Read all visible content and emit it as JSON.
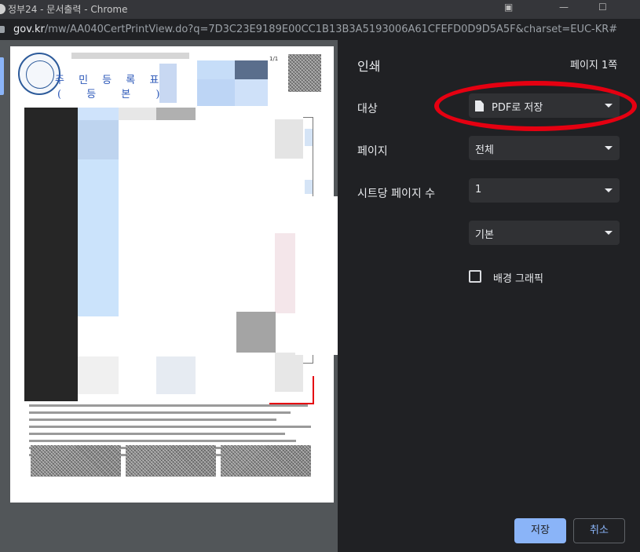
{
  "window": {
    "title": "정부24 - 문서출력 - Chrome",
    "url_host": "gov.kr",
    "url_path": "/mw/AA040CertPrintView.do?q=7D3C23E9189E00CC1B13B3A5193006A61CFEFD0D9D5A5F&charset=EUC-KR#"
  },
  "document": {
    "title": "주 민 등 록 표",
    "subtitle": "( 등 본 )",
    "page_indicator": "1/1"
  },
  "print": {
    "heading": "인쇄",
    "page_count": "페이지 1쪽",
    "destination_label": "대상",
    "destination_value": "PDF로 저장",
    "pages_label": "페이지",
    "pages_value": "전체",
    "per_sheet_label": "시트당 페이지 수",
    "per_sheet_value": "1",
    "margins_value": "기본",
    "background_label": "배경 그래픽",
    "save_button": "저장",
    "cancel_button": "취소"
  },
  "colors": {
    "accent": "#8ab4f8",
    "annotation": "#e50011",
    "panel_bg": "#202124"
  }
}
